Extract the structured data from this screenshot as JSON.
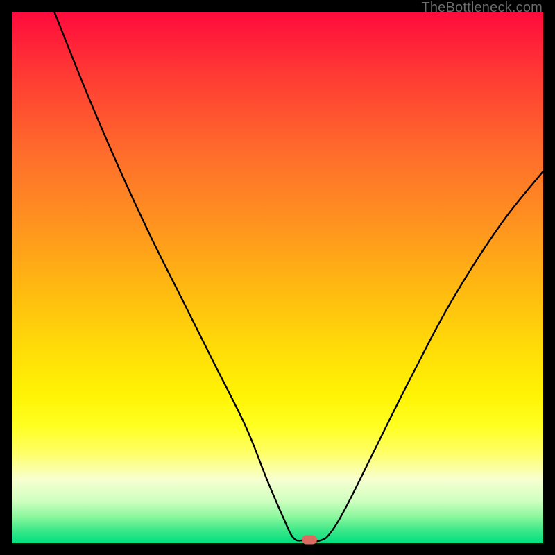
{
  "watermark": "TheBottleneck.com",
  "chart_data": {
    "type": "line",
    "title": "",
    "xlabel": "",
    "ylabel": "",
    "xlim": [
      0,
      100
    ],
    "ylim": [
      0,
      100
    ],
    "background_gradient": {
      "orientation": "vertical",
      "stops": [
        {
          "pos": 0,
          "color": "#FF0A3C"
        },
        {
          "pos": 27,
          "color": "#FF6E2B"
        },
        {
          "pos": 52,
          "color": "#FFB911"
        },
        {
          "pos": 72,
          "color": "#FFF304"
        },
        {
          "pos": 88,
          "color": "#F7FFD0"
        },
        {
          "pos": 100,
          "color": "#00E080"
        }
      ]
    },
    "series": [
      {
        "name": "bottleneck-curve",
        "color": "#000000",
        "points": [
          {
            "x": 8,
            "y": 100
          },
          {
            "x": 14,
            "y": 85
          },
          {
            "x": 20,
            "y": 71
          },
          {
            "x": 26,
            "y": 58
          },
          {
            "x": 32,
            "y": 46
          },
          {
            "x": 38,
            "y": 34
          },
          {
            "x": 44,
            "y": 22
          },
          {
            "x": 48,
            "y": 12
          },
          {
            "x": 51,
            "y": 5
          },
          {
            "x": 53,
            "y": 1
          },
          {
            "x": 55,
            "y": 0.5
          },
          {
            "x": 58,
            "y": 0.5
          },
          {
            "x": 60,
            "y": 2
          },
          {
            "x": 63,
            "y": 7
          },
          {
            "x": 68,
            "y": 17
          },
          {
            "x": 75,
            "y": 31
          },
          {
            "x": 83,
            "y": 46
          },
          {
            "x": 92,
            "y": 60
          },
          {
            "x": 100,
            "y": 70
          }
        ]
      }
    ],
    "marker": {
      "x": 56,
      "y": 0.7,
      "color": "#DB6A60"
    }
  }
}
